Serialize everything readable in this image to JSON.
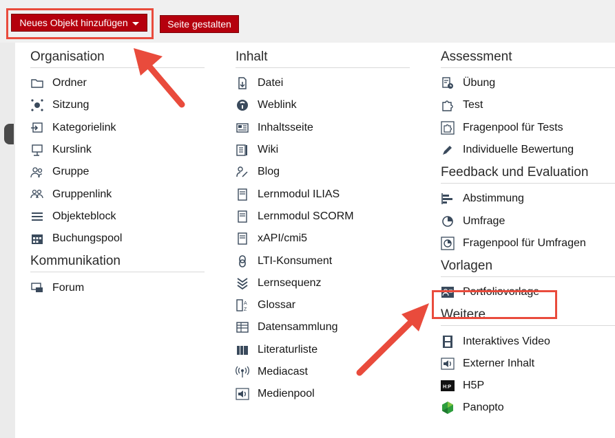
{
  "toolbar": {
    "add_button_label": "Neues Objekt hinzufügen",
    "design_button_label": "Seite gestalten"
  },
  "columns": [
    {
      "groups": [
        {
          "title": "Organisation",
          "items": [
            {
              "label": "Ordner",
              "icon": "folder-icon"
            },
            {
              "label": "Sitzung",
              "icon": "session-icon"
            },
            {
              "label": "Kategorielink",
              "icon": "category-link-icon"
            },
            {
              "label": "Kurslink",
              "icon": "course-link-icon"
            },
            {
              "label": "Gruppe",
              "icon": "group-icon"
            },
            {
              "label": "Gruppenlink",
              "icon": "group-link-icon"
            },
            {
              "label": "Objekteblock",
              "icon": "list-icon"
            },
            {
              "label": "Buchungspool",
              "icon": "calendar-icon"
            }
          ]
        },
        {
          "title": "Kommunikation",
          "items": [
            {
              "label": "Forum",
              "icon": "forum-icon"
            }
          ]
        }
      ]
    },
    {
      "groups": [
        {
          "title": "Inhalt",
          "items": [
            {
              "label": "Datei",
              "icon": "file-icon"
            },
            {
              "label": "Weblink",
              "icon": "weblink-icon"
            },
            {
              "label": "Inhaltsseite",
              "icon": "content-page-icon"
            },
            {
              "label": "Wiki",
              "icon": "wiki-icon"
            },
            {
              "label": "Blog",
              "icon": "blog-icon"
            },
            {
              "label": "Lernmodul ILIAS",
              "icon": "module-icon"
            },
            {
              "label": "Lernmodul SCORM",
              "icon": "module-icon"
            },
            {
              "label": "xAPI/cmi5",
              "icon": "module-icon"
            },
            {
              "label": "LTI-Konsument",
              "icon": "lti-icon"
            },
            {
              "label": "Lernsequenz",
              "icon": "sequence-icon"
            },
            {
              "label": "Glossar",
              "icon": "glossary-icon"
            },
            {
              "label": "Datensammlung",
              "icon": "table-icon"
            },
            {
              "label": "Literaturliste",
              "icon": "books-icon"
            },
            {
              "label": "Mediacast",
              "icon": "broadcast-icon"
            },
            {
              "label": "Medienpool",
              "icon": "speaker-icon"
            }
          ]
        }
      ]
    },
    {
      "groups": [
        {
          "title": "Assessment",
          "items": [
            {
              "label": "Übung",
              "icon": "exercise-icon"
            },
            {
              "label": "Test",
              "icon": "puzzle-icon"
            },
            {
              "label": "Fragenpool für Tests",
              "icon": "puzzle-pool-icon"
            },
            {
              "label": "Individuelle Bewertung",
              "icon": "pen-icon"
            }
          ]
        },
        {
          "title": "Feedback und Evaluation",
          "items": [
            {
              "label": "Abstimmung",
              "icon": "bar-chart-icon"
            },
            {
              "label": "Umfrage",
              "icon": "pie-chart-icon"
            },
            {
              "label": "Fragenpool für Umfragen",
              "icon": "pie-pool-icon"
            }
          ]
        },
        {
          "title": "Vorlagen",
          "items": [
            {
              "label": "Portfoliovorlage",
              "icon": "portfolio-icon"
            }
          ]
        },
        {
          "title": "Weitere",
          "items": [
            {
              "label": "Interaktives Video",
              "icon": "film-icon"
            },
            {
              "label": "Externer Inhalt",
              "icon": "speaker-icon"
            },
            {
              "label": "H5P",
              "icon": "h5p-icon",
              "badge": "H:P"
            },
            {
              "label": "Panopto",
              "icon": "panopto-icon"
            }
          ]
        }
      ]
    }
  ],
  "colors": {
    "button": "#b5000d",
    "highlight": "#e94b3c",
    "icon": "#3a4a5c"
  }
}
